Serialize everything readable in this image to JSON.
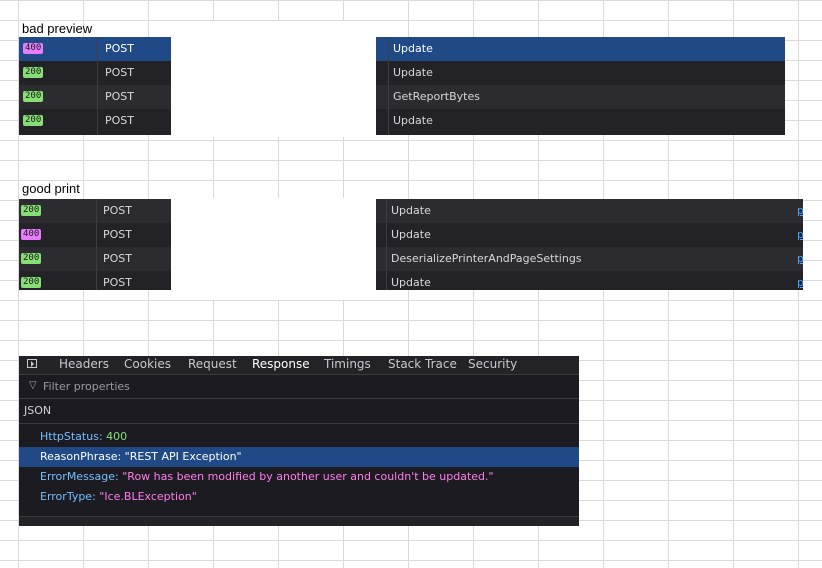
{
  "bad_preview": {
    "label": "bad preview",
    "rows": [
      {
        "status": "400",
        "method": "POST",
        "name": "Update"
      },
      {
        "status": "200",
        "method": "POST",
        "name": "Update"
      },
      {
        "status": "200",
        "method": "POST",
        "name": "GetReportBytes"
      },
      {
        "status": "200",
        "method": "POST",
        "name": "Update"
      }
    ]
  },
  "good_print": {
    "label": "good print",
    "rows": [
      {
        "status": "200",
        "method": "POST",
        "name": "Update"
      },
      {
        "status": "400",
        "method": "POST",
        "name": "Update"
      },
      {
        "status": "200",
        "method": "POST",
        "name": "DeserializePrinterAndPageSettings"
      },
      {
        "status": "200",
        "method": "POST",
        "name": "Update"
      }
    ],
    "edge_link": "p"
  },
  "devtools": {
    "tabs": [
      "Headers",
      "Cookies",
      "Request",
      "Response",
      "Timings",
      "Stack Trace",
      "Security"
    ],
    "active_tab": "Response",
    "filter_placeholder": "Filter properties",
    "section": "JSON",
    "properties": [
      {
        "key": "HttpStatus",
        "value": "400",
        "type": "number"
      },
      {
        "key": "ReasonPhrase",
        "value": "\"REST API Exception\"",
        "type": "string"
      },
      {
        "key": "ErrorMessage",
        "value": "\"Row has been modified by another user and couldn't be updated.\"",
        "type": "string"
      },
      {
        "key": "ErrorType",
        "value": "\"Ice.BLException\"",
        "type": "string"
      }
    ]
  },
  "colors": {
    "selected_row": "#1f4a85",
    "badge_200": "#86de74",
    "badge_400": "#e87eff",
    "panel_bg": "#1c1b22"
  },
  "icons": [
    "panel-toggle-icon",
    "filter-icon"
  ]
}
